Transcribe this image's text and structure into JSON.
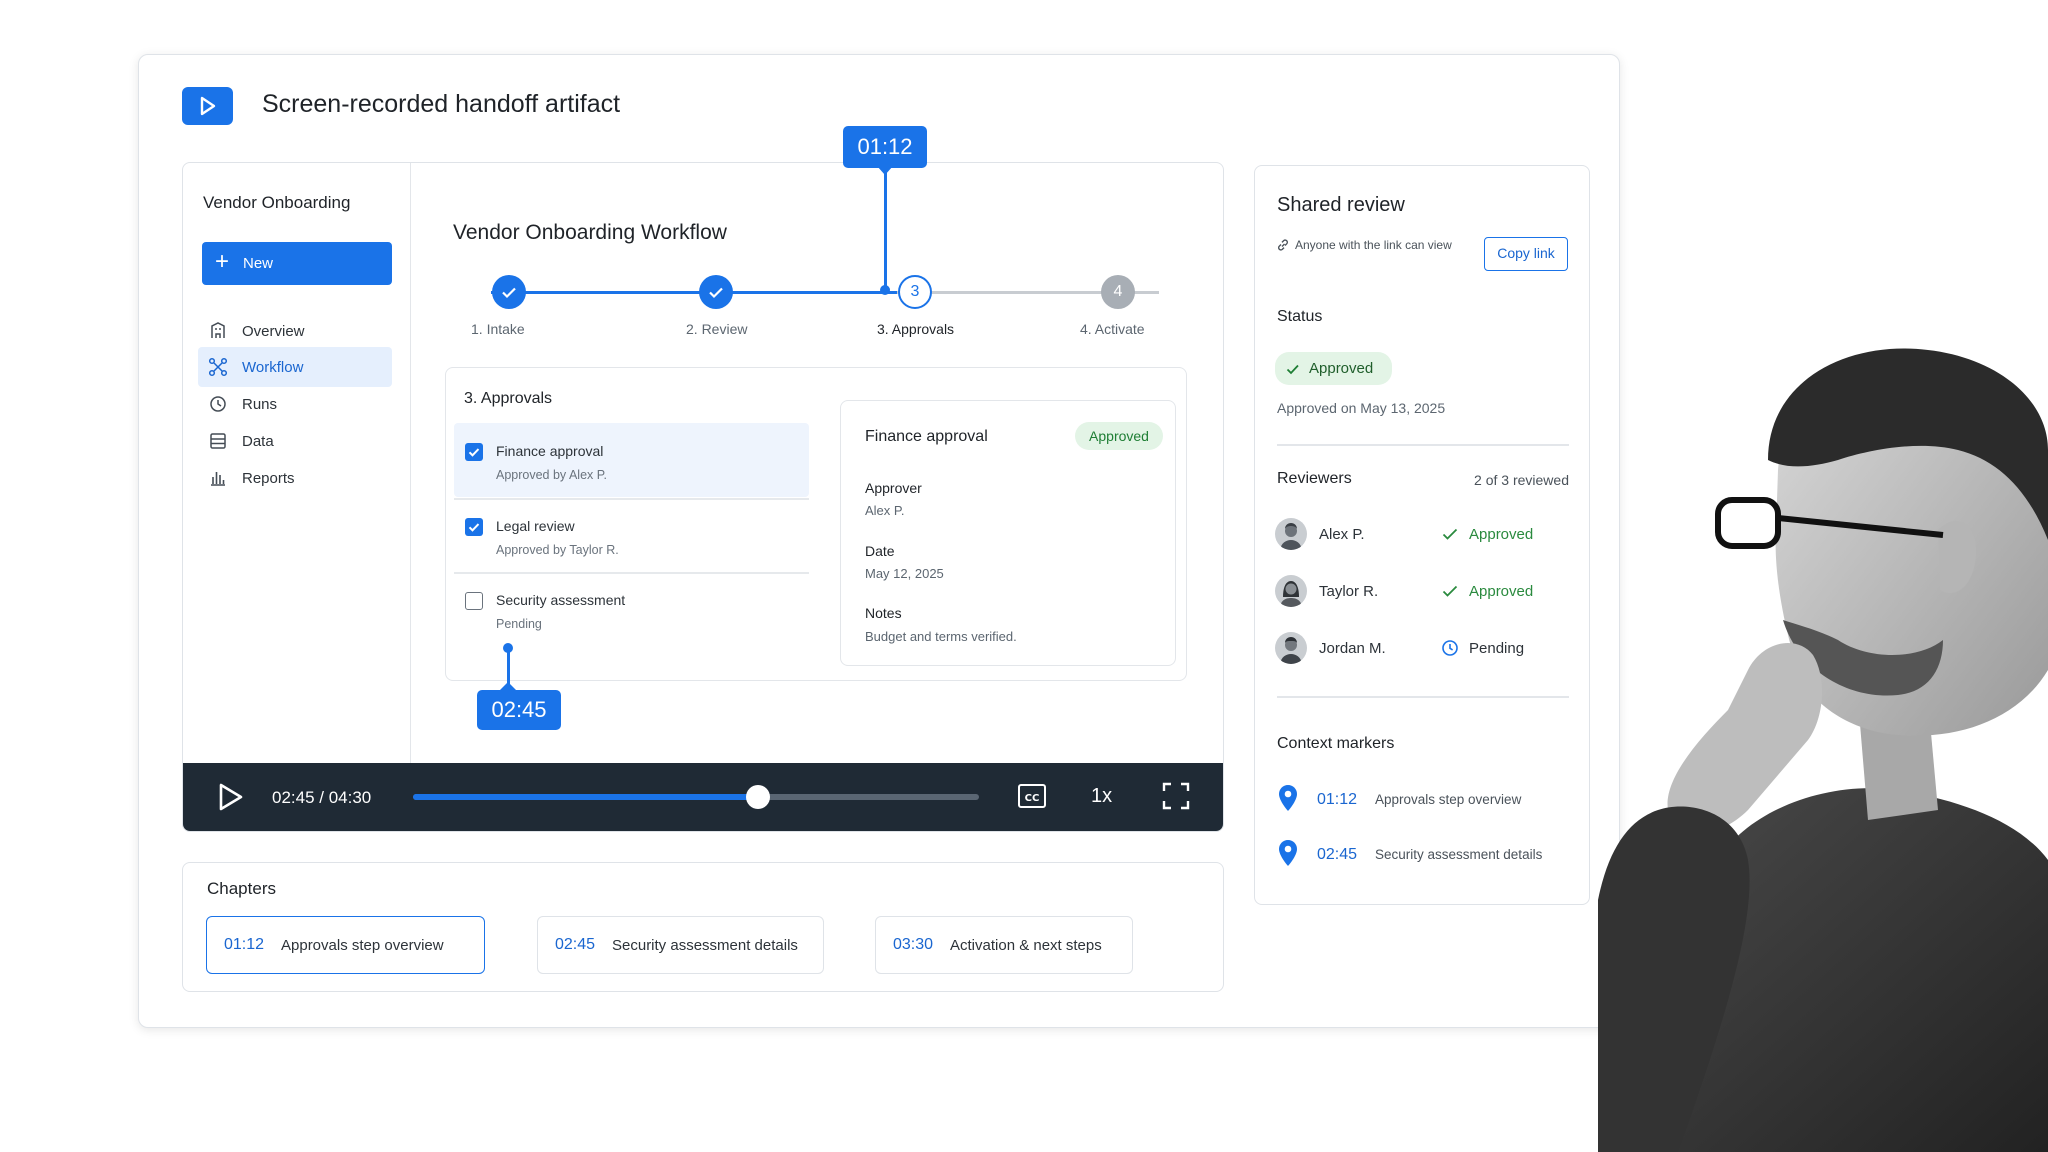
{
  "app": {
    "title": "Screen-recorded handoff artifact",
    "logo_icon": "play-icon"
  },
  "sidebar": {
    "title": "Vendor Onboarding",
    "new_label": "New",
    "items": [
      {
        "label": "Overview",
        "icon": "building-icon"
      },
      {
        "label": "Workflow",
        "icon": "workflow-icon",
        "active": true
      },
      {
        "label": "Runs",
        "icon": "history-icon"
      },
      {
        "label": "Data",
        "icon": "table-icon"
      },
      {
        "label": "Reports",
        "icon": "bar-chart-icon"
      }
    ]
  },
  "workflow": {
    "title": "Vendor Onboarding Workflow",
    "steps": [
      {
        "label": "1. Intake",
        "state": "done"
      },
      {
        "label": "2. Review",
        "state": "done"
      },
      {
        "label": "3. Approvals",
        "state": "current",
        "number": "3"
      },
      {
        "label": "4. Activate",
        "state": "todo",
        "number": "4"
      }
    ],
    "section_title": "3. Approvals",
    "checklist": [
      {
        "title": "Finance approval",
        "sub": "Approved by Alex P.",
        "checked": true
      },
      {
        "title": "Legal review",
        "sub": "Approved by Taylor R.",
        "checked": true
      },
      {
        "title": "Security assessment",
        "sub": "Pending",
        "checked": false
      }
    ],
    "detail": {
      "title": "Finance approval",
      "badge": "Approved",
      "approver_label": "Approver",
      "approver": "Alex P.",
      "date_label": "Date",
      "date": "May 12, 2025",
      "notes_label": "Notes",
      "notes": "Budget and terms verified."
    }
  },
  "markers": {
    "top": "01:12",
    "bottom": "02:45"
  },
  "player": {
    "time": "02:45 / 04:30",
    "progress": 0.61,
    "speed": "1x"
  },
  "chapters": {
    "title": "Chapters",
    "items": [
      {
        "time": "01:12",
        "label": "Approvals step overview",
        "active": true
      },
      {
        "time": "02:45",
        "label": "Security assessment details"
      },
      {
        "time": "03:30",
        "label": "Activation & next steps"
      }
    ]
  },
  "review": {
    "title": "Shared review",
    "share_note": "Anyone with the link can view",
    "copy_label": "Copy link",
    "status_label": "Status",
    "status_badge": "Approved",
    "approved_on": "Approved on May 13, 2025",
    "reviewers_label": "Reviewers",
    "reviewed_count": "2 of 3 reviewed",
    "reviewers": [
      {
        "name": "Alex P.",
        "status": "Approved"
      },
      {
        "name": "Taylor R.",
        "status": "Approved"
      },
      {
        "name": "Jordan M.",
        "status": "Pending"
      }
    ],
    "context_label": "Context markers",
    "context": [
      {
        "time": "01:12",
        "label": "Approvals step overview"
      },
      {
        "time": "02:45",
        "label": "Security assessment details"
      }
    ]
  },
  "colors": {
    "accent": "#1a73e8",
    "success": "#2a8a3e",
    "player_bg": "#1f2a35"
  }
}
